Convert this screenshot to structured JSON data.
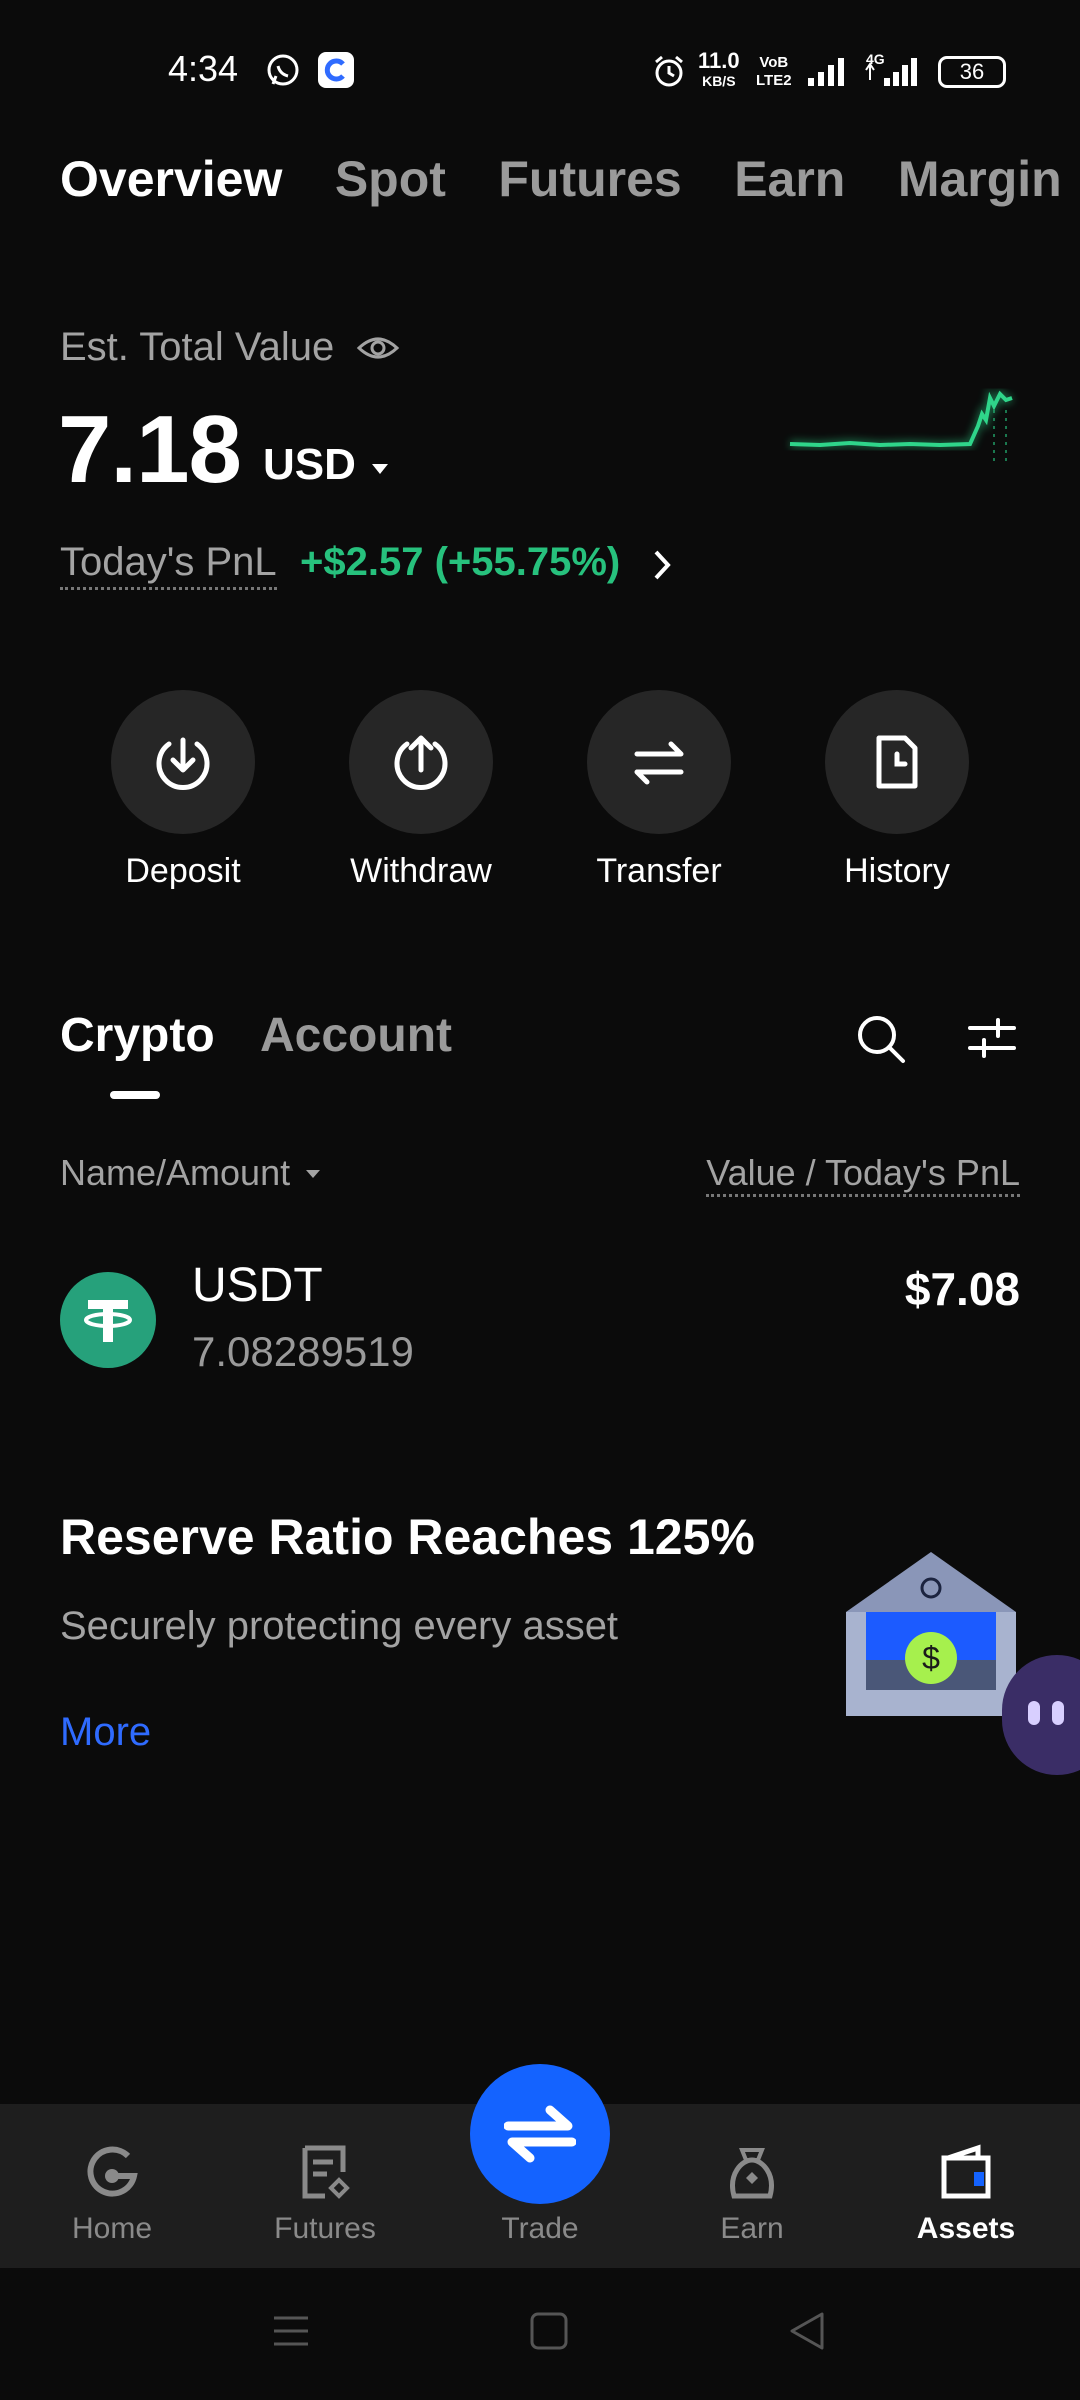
{
  "status_bar": {
    "time": "4:34",
    "net_speed_top": "11.0",
    "net_speed_unit": "KB/S",
    "volte_top": "VoB",
    "volte_bottom": "LTE2",
    "network_type": "4G",
    "battery": "36"
  },
  "top_tabs": [
    "Overview",
    "Spot",
    "Futures",
    "Earn",
    "Margin"
  ],
  "overview": {
    "est_label": "Est. Total Value",
    "total_value": "7.18",
    "currency": "USD",
    "pnl_label": "Today's PnL",
    "pnl_value": "+$2.57 (+55.75%)",
    "colors": {
      "positive": "#27c17d",
      "accent": "#1463ff",
      "link": "#2f6bff"
    }
  },
  "actions": [
    {
      "label": "Deposit",
      "icon": "deposit-icon"
    },
    {
      "label": "Withdraw",
      "icon": "withdraw-icon"
    },
    {
      "label": "Transfer",
      "icon": "transfer-icon"
    },
    {
      "label": "History",
      "icon": "history-icon"
    }
  ],
  "asset_tabs": [
    "Crypto",
    "Account"
  ],
  "asset_list": {
    "col_name": "Name/Amount",
    "col_value": "Value / Today's PnL",
    "rows": [
      {
        "symbol": "USDT",
        "amount": "7.08289519",
        "value": "$7.08",
        "icon": "tether-icon"
      }
    ]
  },
  "promo": {
    "title": "Reserve Ratio Reaches 125%",
    "subtitle": "Securely protecting every asset",
    "more": "More"
  },
  "bottom_nav": [
    {
      "label": "Home",
      "icon": "home-icon"
    },
    {
      "label": "Futures",
      "icon": "futures-icon"
    },
    {
      "label": "Trade",
      "icon": "trade-icon"
    },
    {
      "label": "Earn",
      "icon": "earn-icon"
    },
    {
      "label": "Assets",
      "icon": "wallet-icon",
      "active": true
    }
  ]
}
